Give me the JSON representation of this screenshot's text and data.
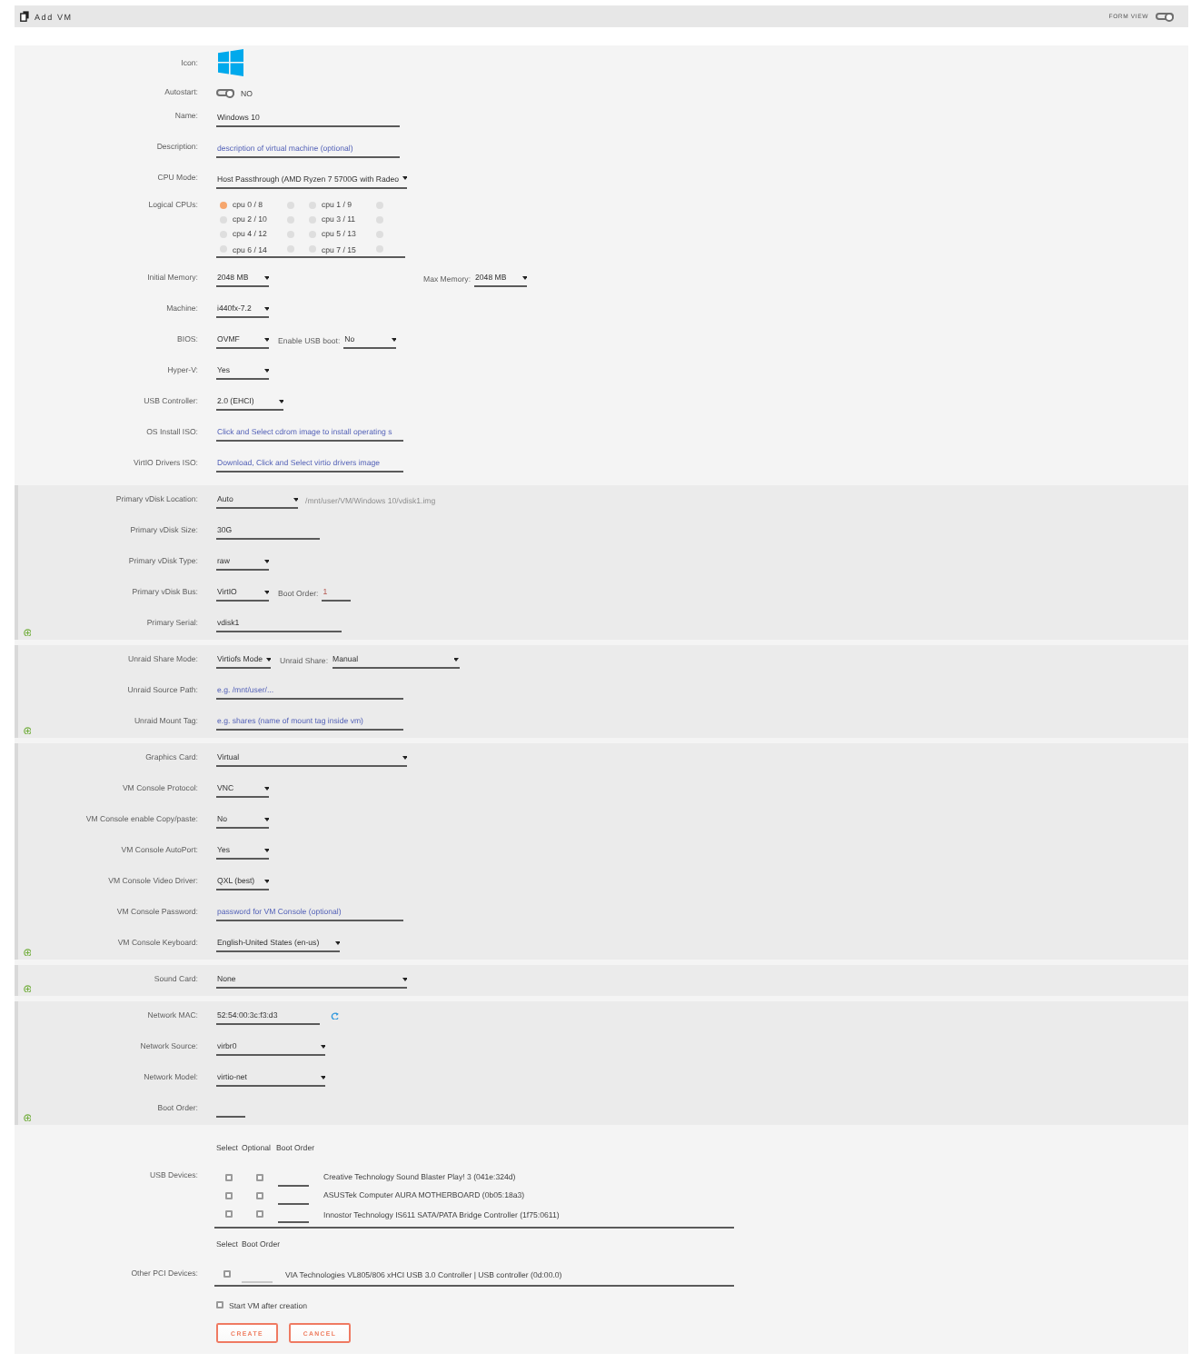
{
  "header": {
    "title": "Add VM",
    "form_view": {
      "label": "FORM VIEW",
      "on": false
    }
  },
  "sections": [
    {
      "kind": "plain",
      "rows": [
        {
          "kind": "icon",
          "label": "Icon:"
        },
        {
          "kind": "toggle",
          "label": "Autostart:",
          "on": false,
          "state_text": "NO"
        },
        {
          "kind": "text",
          "label": "Name:",
          "value": "Windows 10"
        },
        {
          "kind": "text",
          "label": "Description:",
          "placeholder": "description of virtual machine (optional)"
        },
        {
          "kind": "select",
          "label": "CPU Mode:",
          "value": "Host Passthrough (AMD Ryzen 7 5700G with Radeo"
        },
        {
          "kind": "cpus",
          "label": "Logical CPUs:",
          "cpus": [
            {
              "label": "cpu 0 / 8",
              "threads": [
                {
                  "checked": true
                },
                {
                  "checked": false
                }
              ]
            },
            {
              "label": "cpu 1 / 9",
              "threads": [
                {
                  "checked": false
                },
                {
                  "checked": false
                }
              ]
            },
            {
              "label": "cpu 2 / 10",
              "threads": [
                {
                  "checked": false
                },
                {
                  "checked": false
                }
              ]
            },
            {
              "label": "cpu 3 / 11",
              "threads": [
                {
                  "checked": false
                },
                {
                  "checked": false
                }
              ]
            },
            {
              "label": "cpu 4 / 12",
              "threads": [
                {
                  "checked": false
                },
                {
                  "checked": false
                }
              ]
            },
            {
              "label": "cpu 5 / 13",
              "threads": [
                {
                  "checked": false
                },
                {
                  "checked": false
                }
              ]
            },
            {
              "label": "cpu 6 / 14",
              "threads": [
                {
                  "checked": false
                },
                {
                  "checked": false
                }
              ]
            },
            {
              "label": "cpu 7 / 15",
              "threads": [
                {
                  "checked": false
                },
                {
                  "checked": false
                }
              ]
            }
          ]
        },
        {
          "kind": "select",
          "label": "Initial Memory:",
          "value": "2048 MB",
          "extras": [
            {
              "kind": "select",
              "label": "Max Memory:",
              "value": "2048 MB"
            }
          ]
        },
        {
          "kind": "select",
          "label": "Machine:",
          "value": "i440fx-7.2"
        },
        {
          "kind": "select",
          "label": "BIOS:",
          "value": "OVMF",
          "extras": [
            {
              "kind": "select",
              "label": "Enable USB boot:",
              "value": "No"
            }
          ]
        },
        {
          "kind": "select",
          "label": "Hyper-V:",
          "value": "Yes"
        },
        {
          "kind": "select",
          "label": "USB Controller:",
          "value": "2.0 (EHCI)"
        },
        {
          "kind": "text",
          "label": "OS Install ISO:",
          "placeholder": "Click and Select cdrom image to install operating s"
        },
        {
          "kind": "text",
          "label": "VirtIO Drivers ISO:",
          "placeholder": "Download, Click and Select virtio drivers image"
        }
      ]
    },
    {
      "kind": "group",
      "rows": [
        {
          "kind": "select",
          "label": "Primary vDisk Location:",
          "value": "Auto",
          "extras": [
            {
              "kind": "note",
              "text": "/mnt/user/VM/Windows 10/vdisk1.img"
            }
          ]
        },
        {
          "kind": "text",
          "label": "Primary vDisk Size:",
          "value": "30G"
        },
        {
          "kind": "select",
          "label": "Primary vDisk Type:",
          "value": "raw"
        },
        {
          "kind": "select",
          "label": "Primary vDisk Bus:",
          "value": "VirtIO",
          "extras": [
            {
              "kind": "text",
              "label": "Boot Order:",
              "value": "1"
            }
          ]
        },
        {
          "kind": "text",
          "label": "Primary Serial:",
          "value": "vdisk1"
        }
      ]
    },
    {
      "kind": "group",
      "rows": [
        {
          "kind": "select",
          "label": "Unraid Share Mode:",
          "value": "Virtiofs Mode",
          "extras": [
            {
              "kind": "select",
              "label": "Unraid Share:",
              "value": "Manual"
            }
          ]
        },
        {
          "kind": "text",
          "label": "Unraid Source Path:",
          "placeholder": "e.g. /mnt/user/..."
        },
        {
          "kind": "text",
          "label": "Unraid Mount Tag:",
          "placeholder": "e.g. shares (name of mount tag inside vm)"
        }
      ]
    },
    {
      "kind": "group",
      "rows": [
        {
          "kind": "select",
          "label": "Graphics Card:",
          "value": "Virtual"
        },
        {
          "kind": "select",
          "label": "VM Console Protocol:",
          "value": "VNC"
        },
        {
          "kind": "select",
          "label": "VM Console enable Copy/paste:",
          "value": "No"
        },
        {
          "kind": "select",
          "label": "VM Console AutoPort:",
          "value": "Yes"
        },
        {
          "kind": "select",
          "label": "VM Console Video Driver:",
          "value": "QXL (best)"
        },
        {
          "kind": "text",
          "label": "VM Console Password:",
          "placeholder": "password for VM Console (optional)"
        },
        {
          "kind": "select",
          "label": "VM Console Keyboard:",
          "value": "English-United States (en-us)"
        }
      ]
    },
    {
      "kind": "group",
      "rows": [
        {
          "kind": "select",
          "label": "Sound Card:",
          "value": "None"
        }
      ]
    },
    {
      "kind": "group",
      "rows": [
        {
          "kind": "mac",
          "label": "Network MAC:",
          "value": "52:54:00:3c:f3:d3"
        },
        {
          "kind": "select",
          "label": "Network Source:",
          "value": "virbr0"
        },
        {
          "kind": "select",
          "label": "Network Model:",
          "value": "virtio-net"
        },
        {
          "kind": "text",
          "label": "Boot Order:"
        }
      ]
    }
  ],
  "usb_devices": {
    "label": "USB Devices:",
    "columns": [
      "Select",
      "Optional",
      "Boot Order"
    ],
    "devices": [
      {
        "name": "Creative Technology Sound Blaster Play! 3 (041e:324d)",
        "select": false,
        "optional": false,
        "boot_order_disabled": false
      },
      {
        "name": "ASUSTek Computer AURA MOTHERBOARD (0b05:18a3)",
        "select": false,
        "optional": false,
        "boot_order_disabled": false
      },
      {
        "name": "Innostor Technology IS611 SATA/PATA Bridge Controller (1f75:0611)",
        "select": false,
        "optional": false,
        "boot_order_disabled": false
      }
    ]
  },
  "pci_devices": {
    "label": "Other PCI Devices:",
    "columns": [
      "Select",
      "Boot Order"
    ],
    "devices": [
      {
        "name": "VIA Technologies VL805/806 xHCI USB 3.0 Controller | USB controller (0d:00.0)",
        "select": false,
        "boot_order_disabled": true
      }
    ]
  },
  "start_after_creation": {
    "label": "Start VM after creation",
    "checked": false
  },
  "buttons": [
    {
      "label": "CREATE"
    },
    {
      "label": "CANCEL"
    }
  ]
}
